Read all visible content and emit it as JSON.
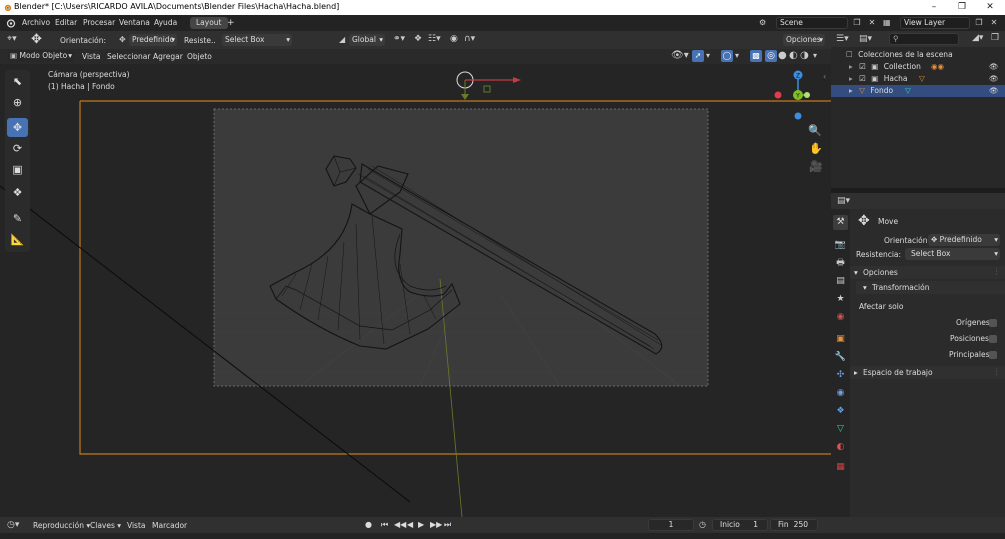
{
  "title_bar": {
    "title": "Blender* [C:\\Users\\RICARDO AVILA\\Documents\\Blender Files\\Hacha\\Hacha.blend]"
  },
  "menu": {
    "items": [
      "Archivo",
      "Editar",
      "Procesar",
      "Ventana",
      "Ayuda"
    ],
    "workspace_tab": "Layout",
    "add_tab": "+",
    "scene_label": "Scene",
    "view_layer_label": "View Layer"
  },
  "header3d": {
    "orientation_label": "Orientación:",
    "orientation_value": "Predefinido",
    "drag_label": "Resiste..",
    "drag_value": "Select Box",
    "transform_orientation": "Global",
    "options_label": "Opciones",
    "mode": "Modo Objeto",
    "menus": [
      "Vista",
      "Seleccionar",
      "Agregar",
      "Objeto"
    ]
  },
  "viewport": {
    "camera_label": "Cámara (perspectiva)",
    "context_label": "(1) Hacha | Fondo"
  },
  "outliner": {
    "search_placeholder": "",
    "root": "Colecciones de la escena",
    "items": [
      {
        "name": "Collection"
      },
      {
        "name": "Hacha"
      },
      {
        "name": "Fondo"
      }
    ]
  },
  "properties": {
    "tool_name": "Move",
    "orientation_label": "Orientación",
    "orientation_value": "Predefinido",
    "drag_label": "Resistencia:",
    "drag_value": "Select Box",
    "options_panel": "Opciones",
    "transform_panel": "Transformación",
    "affect_only": "Afectar solo",
    "origins": "Orígenes",
    "locations": "Posiciones",
    "parents": "Principales",
    "workspace_panel": "Espacio de trabajo"
  },
  "timeline": {
    "playback": "Reproducción",
    "keying": "Claves",
    "view": "Vista",
    "marker": "Marcador",
    "current_frame": "1",
    "start_label": "Inicio",
    "start_value": "1",
    "end_label": "Fin",
    "end_value": "250"
  },
  "colors": {
    "accent": "#4772b3",
    "selection": "#334d80",
    "x_axis": "#e03c4b",
    "y_axis": "#7fbf24",
    "z_axis": "#3b8fe0",
    "camera_frame": "#d08a1e"
  }
}
